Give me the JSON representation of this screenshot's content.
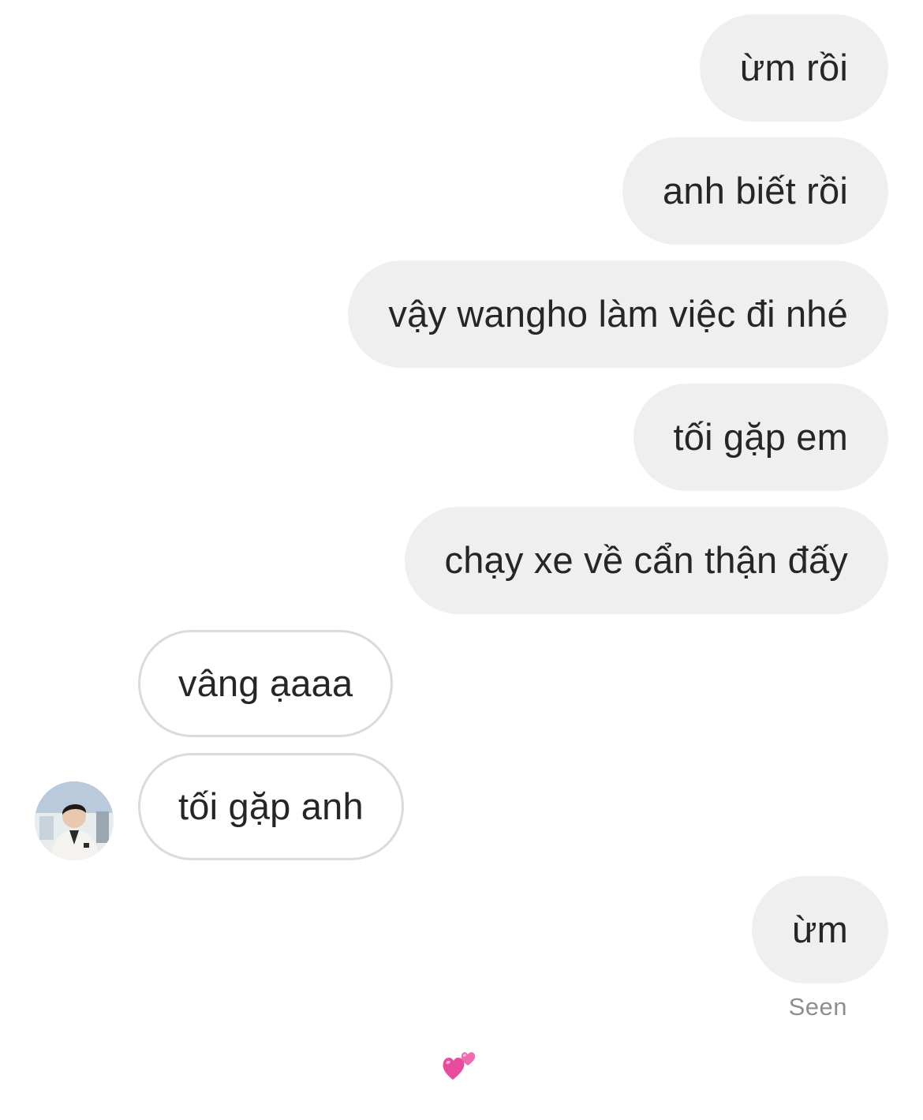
{
  "conversation": {
    "outgoing_top": [
      "ừm rồi",
      "anh biết rồi",
      "vậy wangho làm việc đi nhé",
      "tối gặp em",
      "chạy xe về cẩn thận đấy"
    ],
    "incoming": [
      "vâng ạaaa",
      "tối gặp anh"
    ],
    "outgoing_last": "ừm",
    "seen_label": "Seen"
  },
  "icons": {
    "avatar": "contact-avatar-photo",
    "hearts": "two-hearts-emoji"
  },
  "colors": {
    "outgoing_bubble": "#efefef",
    "incoming_border": "#dbdbdb",
    "text": "#262626",
    "seen_text": "#8e8e8e",
    "heart": "#e84b9c"
  }
}
